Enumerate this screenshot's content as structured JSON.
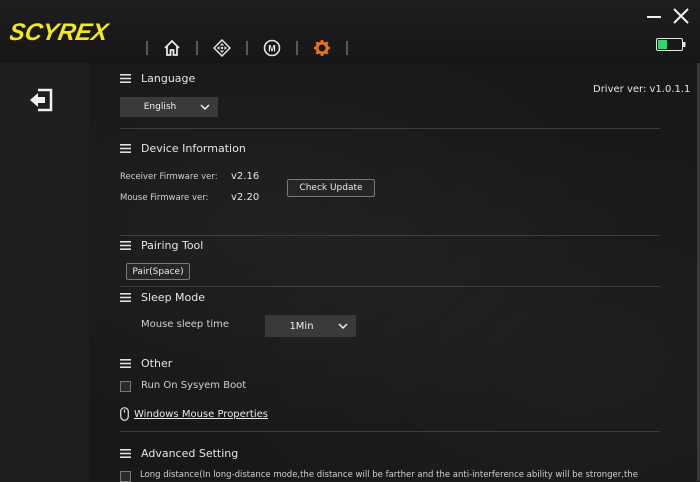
{
  "app": {
    "logo_text": "SCYREX"
  },
  "nav": {
    "items": [
      "home-icon",
      "dpad-icon",
      "macro-icon",
      "settings-icon"
    ],
    "active": "settings-icon",
    "active_color": "#e8731e"
  },
  "window": {
    "minimize": "minimize-icon",
    "close": "close-icon",
    "battery": "battery-icon",
    "battery_color": "#2fd66b"
  },
  "driver_version": "Driver ver: v1.0.1.1",
  "language": {
    "title": "Language",
    "selected": "English"
  },
  "device_info": {
    "title": "Device Information",
    "receiver_label": "Receiver Firmware ver:",
    "receiver_value": "v2.16",
    "mouse_label": "Mouse Firmware ver:",
    "mouse_value": "v2.20",
    "check_update": "Check Update"
  },
  "pairing": {
    "title": "Pairing Tool",
    "button": "Pair(Space)"
  },
  "sleep": {
    "title": "Sleep Mode",
    "label": "Mouse sleep time",
    "selected": "1Min"
  },
  "other": {
    "title": "Other",
    "run_on_boot": "Run On Sysyem Boot",
    "windows_mouse": "Windows Mouse Properties"
  },
  "advanced": {
    "title": "Advanced Setting",
    "long_distance": "Long distance(In long-distance mode,the distance will be farther and the anti-interference ability will be stronger,the"
  }
}
